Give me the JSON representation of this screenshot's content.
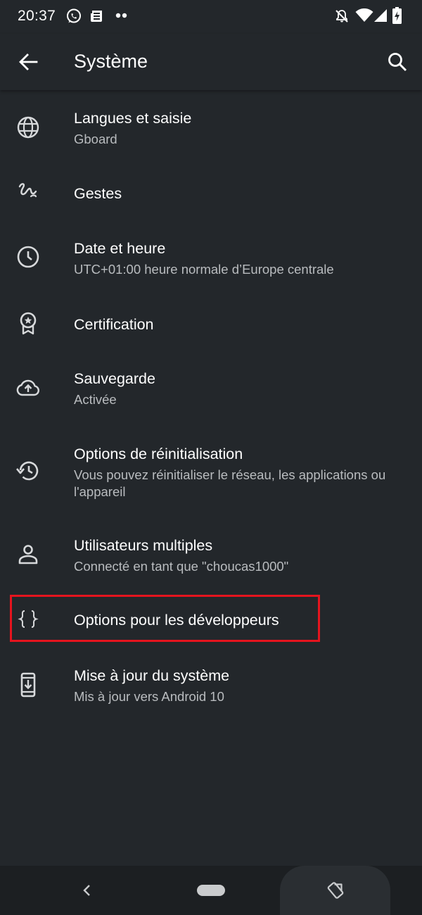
{
  "status_bar": {
    "time": "20:37",
    "left_icons": [
      "whatsapp-icon",
      "news-icon",
      "more-dots-icon"
    ],
    "right_icons": [
      "notifications-off-icon",
      "wifi-icon",
      "signal-icon",
      "battery-charging-icon"
    ]
  },
  "app_bar": {
    "title": "Système",
    "back_icon": "arrow-back-icon",
    "search_icon": "search-icon"
  },
  "items": [
    {
      "title": "Langues et saisie",
      "subtitle": "Gboard",
      "icon": "globe-icon"
    },
    {
      "title": "Gestes",
      "subtitle": "",
      "icon": "gesture-icon"
    },
    {
      "title": "Date et heure",
      "subtitle": "UTC+01:00 heure normale d’Europe centrale",
      "icon": "clock-icon"
    },
    {
      "title": "Certification",
      "subtitle": "",
      "icon": "certificate-icon"
    },
    {
      "title": "Sauvegarde",
      "subtitle": "Activée",
      "icon": "cloud-upload-icon"
    },
    {
      "title": "Options de réinitialisation",
      "subtitle": "Vous pouvez réinitialiser le réseau, les applications ou l'appareil",
      "icon": "history-icon"
    },
    {
      "title": "Utilisateurs multiples",
      "subtitle": "Connecté en tant que \"choucas1000\"",
      "icon": "person-icon"
    },
    {
      "title": "Options pour les développeurs",
      "subtitle": "",
      "icon": "braces-icon"
    },
    {
      "title": "Mise à jour du système",
      "subtitle": "Mis à jour vers Android 10",
      "icon": "system-update-icon"
    }
  ],
  "highlight": {
    "color": "#e5141e",
    "target": "Options pour les développeurs"
  },
  "nav_bar": {
    "back_icon": "nav-back-icon",
    "home_icon": "home-pill-icon",
    "rotate_icon": "rotate-icon"
  },
  "colors": {
    "background": "#23272b",
    "text_primary": "#ffffff",
    "text_secondary": "#b9bcbf",
    "nav_bar": "#1c1f22"
  }
}
